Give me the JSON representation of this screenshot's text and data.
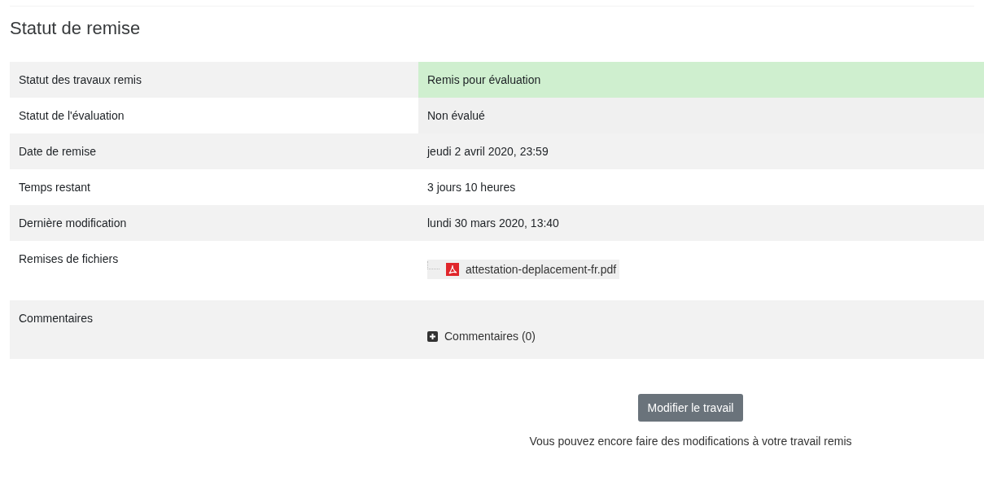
{
  "title": "Statut de remise",
  "rows": [
    {
      "kind": "text",
      "label": "Statut des travaux remis",
      "value": "Remis pour évaluation",
      "color": "#cfefcf"
    },
    {
      "kind": "text",
      "label": "Statut de l'évaluation",
      "value": "Non évalué",
      "color": "#f0f0f0"
    },
    {
      "kind": "text",
      "label": "Date de remise",
      "value": "jeudi 2 avril 2020, 23:59"
    },
    {
      "kind": "text",
      "label": "Temps restant",
      "value": "3 jours 10 heures"
    },
    {
      "kind": "text",
      "label": "Dernière modification",
      "value": "lundi 30 mars 2020, 13:40"
    },
    {
      "kind": "file",
      "label": "Remises de fichiers",
      "value": "attestation-deplacement-fr.pdf"
    },
    {
      "kind": "comments",
      "label": "Commentaires",
      "value": "Commentaires (0)",
      "expanded": false
    }
  ],
  "button": "Modifier le travail",
  "note": "Vous pouvez encore faire des modifications à votre travail remis"
}
